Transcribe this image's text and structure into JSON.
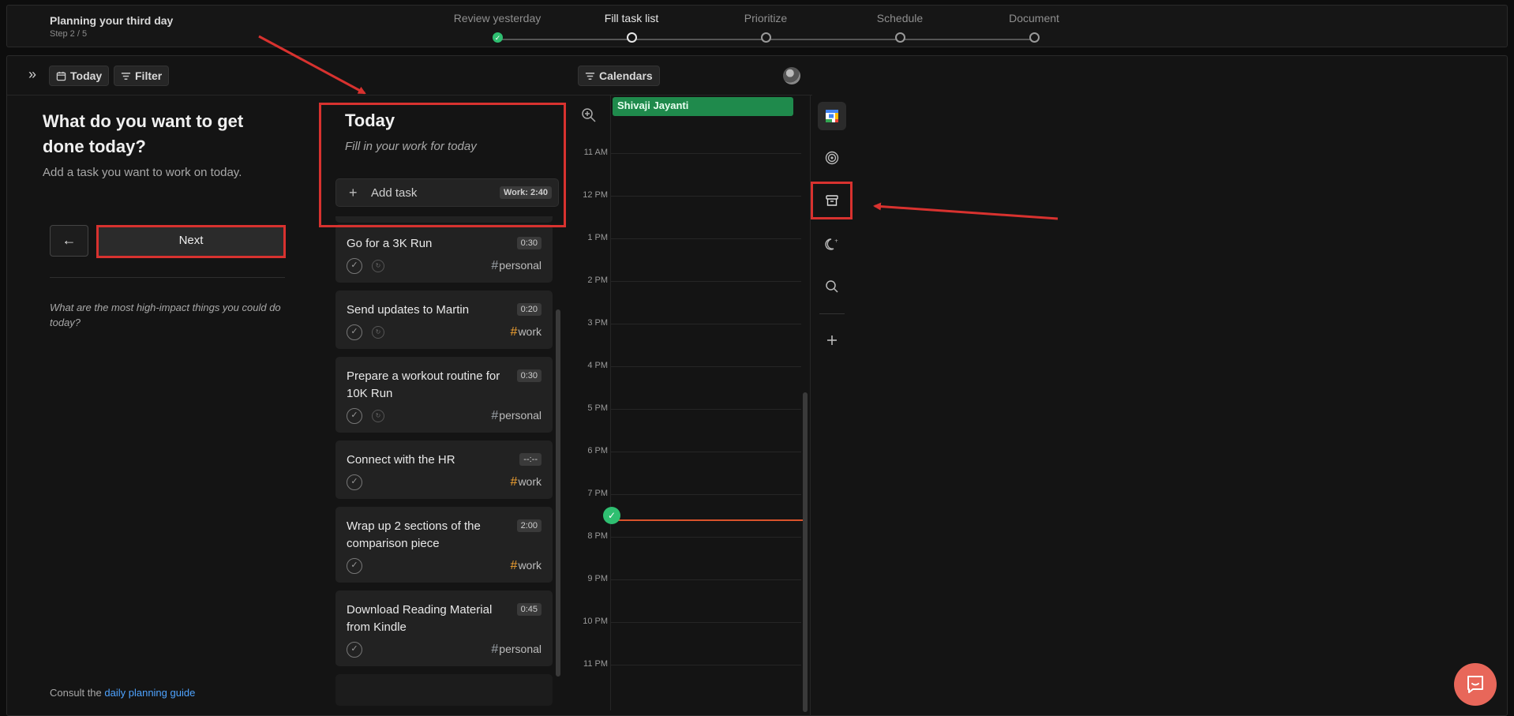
{
  "header": {
    "title": "Planning your third day",
    "step": "Step 2 / 5",
    "steps": [
      {
        "label": "Review yesterday",
        "state": "done"
      },
      {
        "label": "Fill task list",
        "state": "active"
      },
      {
        "label": "Prioritize",
        "state": "todo"
      },
      {
        "label": "Schedule",
        "state": "todo"
      },
      {
        "label": "Document",
        "state": "todo"
      }
    ]
  },
  "toolbar": {
    "today_label": "Today",
    "filter_label": "Filter",
    "calendars_label": "Calendars"
  },
  "left": {
    "heading": "What do you want to get done today?",
    "subheading": "Add a task you want to work on today.",
    "back_symbol": "←",
    "next_label": "Next",
    "hint": "What are the most high-impact things you could do today?",
    "guide_prefix": "Consult the",
    "guide_link": "daily planning guide"
  },
  "today": {
    "title": "Today",
    "subtitle": "Fill in your work for today",
    "add_task_label": "Add task",
    "work_total": "Work: 2:40",
    "tasks": [
      {
        "title": "Go for a 3K Run",
        "duration": "0:30",
        "tag": "personal",
        "repeat": true
      },
      {
        "title": "Send updates to Martin",
        "duration": "0:20",
        "tag": "work",
        "repeat": true
      },
      {
        "title": "Prepare a workout routine for 10K Run",
        "duration": "0:30",
        "tag": "personal",
        "repeat": true
      },
      {
        "title": "Connect with the HR",
        "duration": "--:--",
        "tag": "work",
        "repeat": false
      },
      {
        "title": "Wrap up 2 sections of the comparison piece",
        "duration": "2:00",
        "tag": "work",
        "repeat": false
      },
      {
        "title": "Download Reading Material from Kindle",
        "duration": "0:45",
        "tag": "personal",
        "repeat": false
      }
    ]
  },
  "calendar": {
    "event": "Shivaji Jayanti",
    "hours": [
      "11 AM",
      "12 PM",
      "1 PM",
      "2 PM",
      "3 PM",
      "4 PM",
      "5 PM",
      "6 PM",
      "7 PM",
      "8 PM",
      "9 PM",
      "10 PM",
      "11 PM"
    ]
  },
  "rail": [
    "google-calendar-icon",
    "target-icon",
    "archive-icon",
    "moon-icon",
    "search-icon",
    "plus-icon"
  ],
  "colors": {
    "accent_green": "#2fbf71",
    "event_green": "#1f8a4c",
    "work_tag": "#f0a030",
    "annotation_red": "#d8322f",
    "now_line": "#d9532b",
    "chat": "#e8675a"
  }
}
